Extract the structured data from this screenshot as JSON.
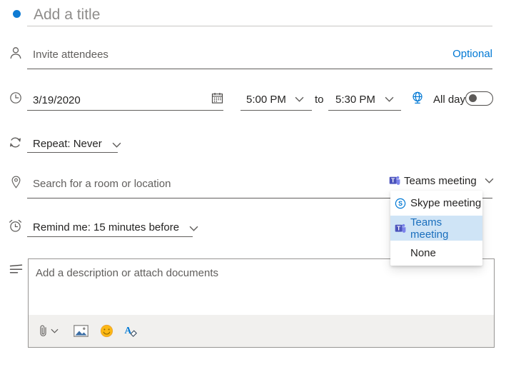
{
  "colors": {
    "accent_blue": "#0078d4",
    "selected_item_bg": "#cfe4f6",
    "selected_item_text": "#1b6fbd",
    "toolbar_bg": "#f1f0ee",
    "text_dark": "#252423",
    "text_muted": "#605e5c"
  },
  "title": {
    "placeholder": "Add a title"
  },
  "attendees": {
    "placeholder": "Invite attendees",
    "optional_label": "Optional"
  },
  "datetime": {
    "date": "3/19/2020",
    "start_time": "5:00 PM",
    "to_label": "to",
    "end_time": "5:30 PM",
    "all_day_label": "All day",
    "all_day_on": false
  },
  "repeat": {
    "label": "Repeat: Never"
  },
  "location": {
    "placeholder": "Search for a room or location"
  },
  "meeting": {
    "selected_label": "Teams meeting",
    "menu_items": [
      {
        "label": "Skype meeting",
        "icon": "skype-icon",
        "selected": false
      },
      {
        "label": "Teams meeting",
        "icon": "teams-icon",
        "selected": true
      },
      {
        "label": "None",
        "icon": "",
        "selected": false
      }
    ]
  },
  "reminder": {
    "label": "Remind me: 15 minutes before"
  },
  "description": {
    "placeholder": "Add a description or attach documents"
  },
  "toolbar": {
    "icons": [
      "attach-icon",
      "insert-image-icon",
      "emoji-icon",
      "clear-formatting-icon"
    ]
  }
}
